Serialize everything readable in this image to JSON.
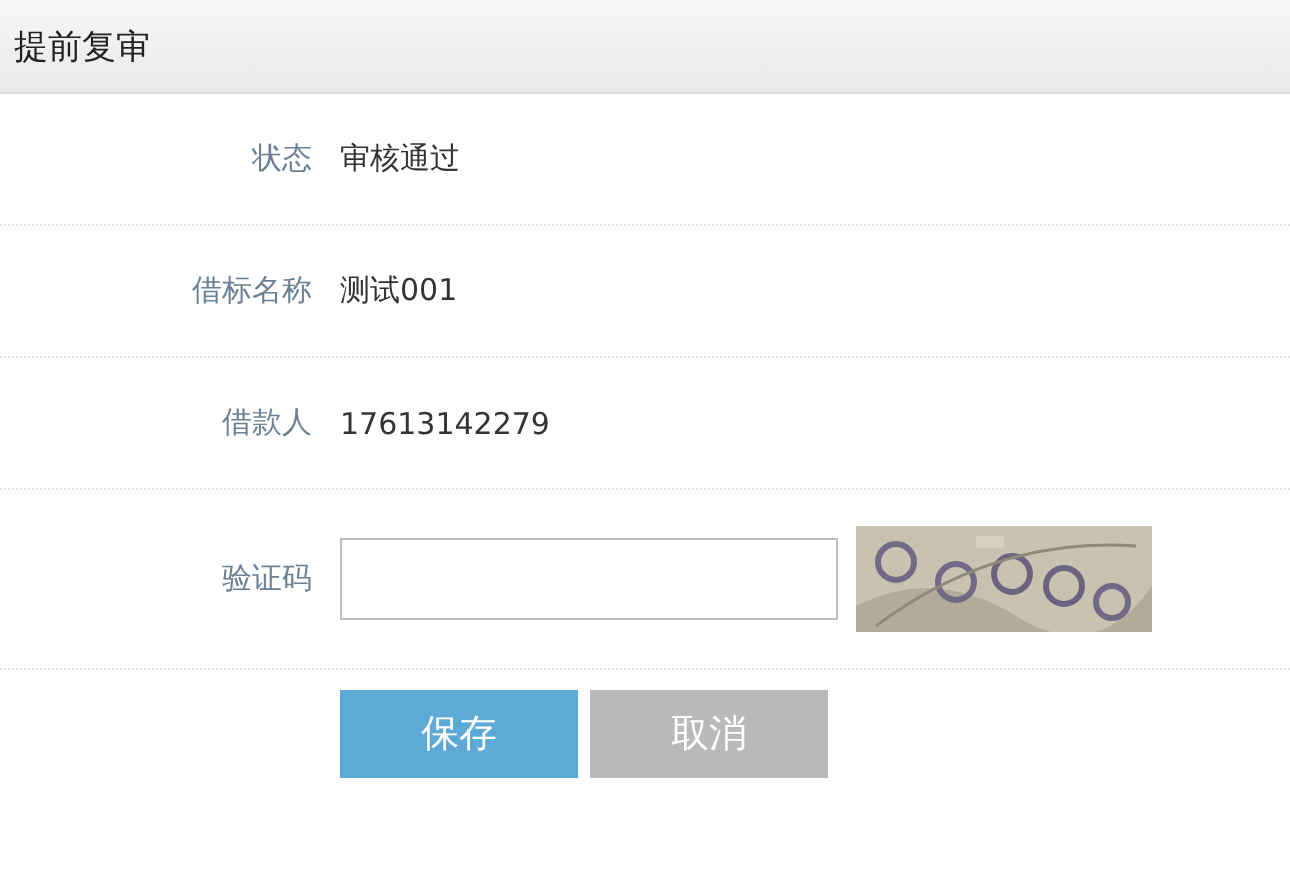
{
  "window": {
    "title": "提前复审"
  },
  "fields": [
    {
      "kind": "text",
      "label": "状态",
      "value": "审核通过"
    },
    {
      "kind": "text",
      "label": "借标名称",
      "value": "测试001"
    },
    {
      "kind": "text",
      "label": "借款人",
      "value": "17613142279"
    },
    {
      "kind": "captcha",
      "label": "验证码"
    }
  ],
  "buttons": [
    {
      "label": "保存",
      "disabled": false
    },
    {
      "label": "取消",
      "disabled": true
    }
  ]
}
